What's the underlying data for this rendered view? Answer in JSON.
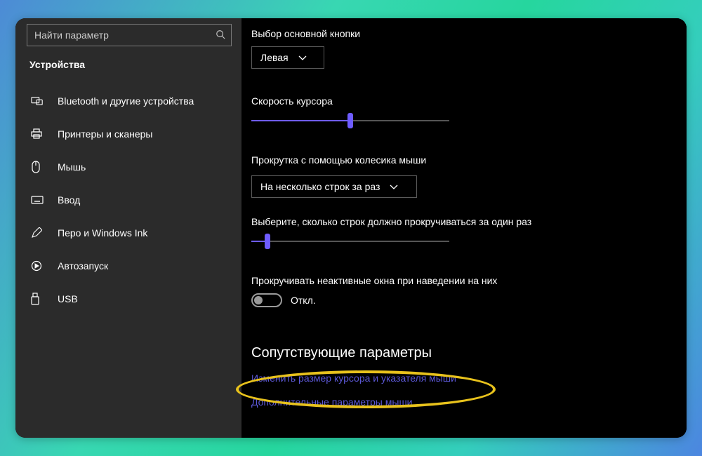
{
  "sidebar": {
    "search_placeholder": "Найти параметр",
    "title": "Устройства",
    "items": [
      {
        "label": "Bluetooth и другие устройства"
      },
      {
        "label": "Принтеры и сканеры"
      },
      {
        "label": "Мышь"
      },
      {
        "label": "Ввод"
      },
      {
        "label": "Перо и Windows Ink"
      },
      {
        "label": "Автозапуск"
      },
      {
        "label": "USB"
      }
    ]
  },
  "main": {
    "primary_button_label": "Выбор основной кнопки",
    "primary_button_value": "Левая",
    "cursor_speed_label": "Скорость курсора",
    "cursor_speed_value": 50,
    "scroll_mode_label": "Прокрутка с помощью колесика мыши",
    "scroll_mode_value": "На несколько строк за раз",
    "scroll_lines_label": "Выберите, сколько строк должно прокручиваться за один раз",
    "scroll_lines_value": 8,
    "inactive_scroll_label": "Прокручивать неактивные окна при наведении на них",
    "inactive_scroll_state": "Откл.",
    "related_heading": "Сопутствующие параметры",
    "link_cursor_size": "Изменить размер курсора и указателя мыши",
    "link_additional": "Дополнительные параметры мыши"
  }
}
